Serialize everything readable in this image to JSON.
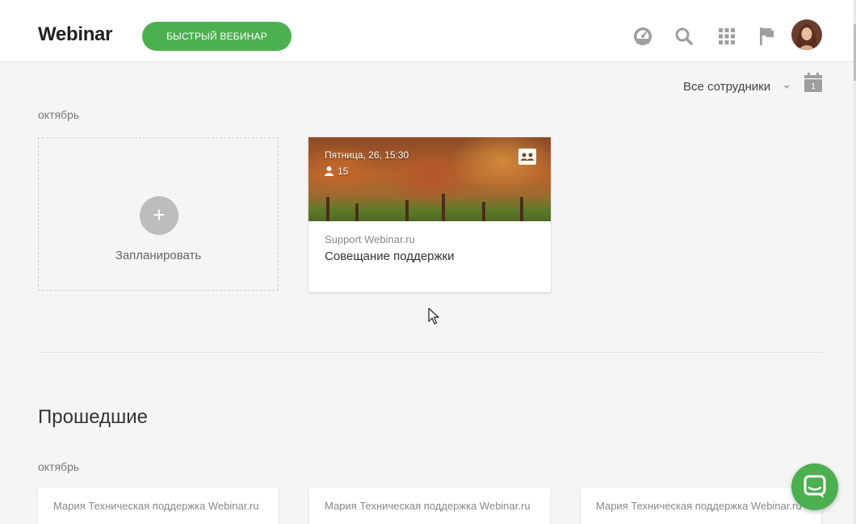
{
  "header": {
    "logo": "Webinar",
    "quick_button": "БЫСТРЫЙ ВЕБИНАР",
    "icons": [
      "dashboard-icon",
      "search-icon",
      "apps-grid-icon",
      "flag-icon"
    ]
  },
  "filter": {
    "label": "Все сотрудники",
    "calendar_day": "1"
  },
  "upcoming": {
    "month": "октябрь",
    "plan_label": "Запланировать",
    "plan_symbol": "+",
    "event": {
      "date": "Пятница, 26, 15:30",
      "participants": "15",
      "organizer": "Support Webinar.ru",
      "title": "Совещание поддержки"
    }
  },
  "past": {
    "title": "Прошедшие",
    "month": "октябрь",
    "cards": [
      {
        "organizer": "Мария Техническая поддержка Webinar.ru"
      },
      {
        "organizer": "Мария Техническая поддержка Webinar.ru"
      },
      {
        "organizer": "Мария Техническая поддержка Webinar.ru"
      }
    ]
  },
  "colors": {
    "accent": "#4caf50",
    "icon_gray": "#9e9e9e",
    "background": "#f5f5f5"
  }
}
